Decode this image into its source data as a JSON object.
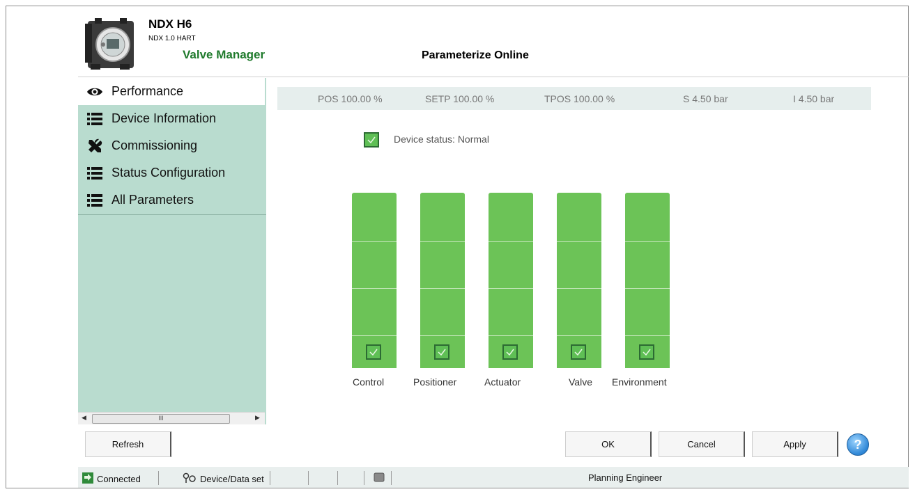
{
  "header": {
    "device_name": "NDX H6",
    "device_subtitle": "NDX 1.0 HART",
    "product_name": "Valve Manager",
    "page_title": "Parameterize Online"
  },
  "sidebar": {
    "items": [
      {
        "label": "Performance",
        "icon": "eye-icon",
        "active": true
      },
      {
        "label": "Device Information",
        "icon": "list-icon"
      },
      {
        "label": "Commissioning",
        "icon": "tools-icon"
      },
      {
        "label": "Status Configuration",
        "icon": "list-icon"
      },
      {
        "label": "All Parameters",
        "icon": "list-icon"
      }
    ],
    "scroll_thumb": "III"
  },
  "readouts": [
    {
      "text": "POS  100.00  %"
    },
    {
      "text": "SETP  100.00  %"
    },
    {
      "text": "TPOS  100.00  %"
    },
    {
      "text": "S  4.50  bar"
    },
    {
      "text": "I  4.50  bar"
    }
  ],
  "device_status": {
    "label": "Device status: Normal",
    "checked": true
  },
  "indicators": [
    {
      "label": "Control",
      "status": "ok"
    },
    {
      "label": "Positioner",
      "status": "ok"
    },
    {
      "label": "Actuator",
      "status": "ok"
    },
    {
      "label": "Valve",
      "status": "ok"
    },
    {
      "label": "Environment",
      "status": "ok"
    }
  ],
  "buttons": {
    "refresh": "Refresh",
    "ok": "OK",
    "cancel": "Cancel",
    "apply": "Apply",
    "help": "?"
  },
  "statusbar": {
    "connection": "Connected",
    "dataset": "Device/Data set",
    "role": "Planning Engineer"
  },
  "colors": {
    "accent_green": "#1f7a2c",
    "sidebar_bg": "#b9dccf",
    "indicator_green": "#6cc357"
  }
}
